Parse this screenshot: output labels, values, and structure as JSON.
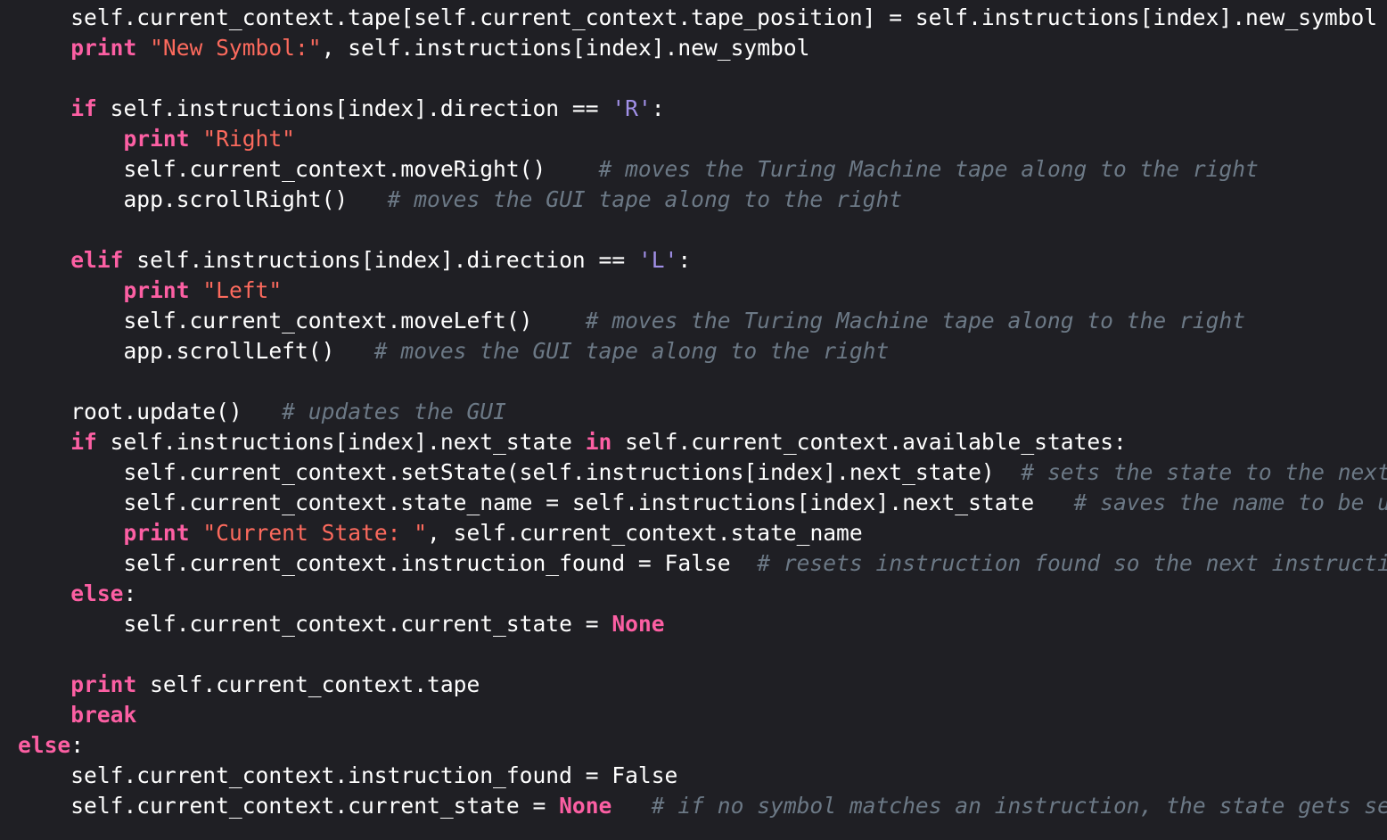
{
  "colors": {
    "background": "#1f1f24",
    "plain": "#ffffff",
    "keyword": "#fc5fa3",
    "string": "#fc6a5d",
    "char_literal": "#a190e8",
    "comment": "#6c7986"
  },
  "lines": [
    {
      "indent": 1,
      "tokens": [
        {
          "t": "self.current_context.tape[self.current_context.tape_position] = self.instructions[index].new_symbol",
          "k": "id"
        }
      ]
    },
    {
      "indent": 1,
      "tokens": [
        {
          "t": "print",
          "k": "kw"
        },
        {
          "t": " ",
          "k": "id"
        },
        {
          "t": "\"New Symbol:\"",
          "k": "str"
        },
        {
          "t": ", self.instructions[index].new_symbol",
          "k": "id"
        }
      ]
    },
    {
      "indent": 0,
      "tokens": []
    },
    {
      "indent": 1,
      "tokens": [
        {
          "t": "if",
          "k": "kw"
        },
        {
          "t": " self.instructions[index].direction == ",
          "k": "id"
        },
        {
          "t": "'R'",
          "k": "chr"
        },
        {
          "t": ":",
          "k": "id"
        }
      ]
    },
    {
      "indent": 2,
      "tokens": [
        {
          "t": "print",
          "k": "kw"
        },
        {
          "t": " ",
          "k": "id"
        },
        {
          "t": "\"Right\"",
          "k": "str"
        }
      ]
    },
    {
      "indent": 2,
      "tokens": [
        {
          "t": "self.current_context.moveRight()    ",
          "k": "id"
        },
        {
          "t": "# moves the Turing Machine tape along to the right",
          "k": "cmt"
        }
      ]
    },
    {
      "indent": 2,
      "tokens": [
        {
          "t": "app.scrollRight()   ",
          "k": "id"
        },
        {
          "t": "# moves the GUI tape along to the right",
          "k": "cmt"
        }
      ]
    },
    {
      "indent": 0,
      "tokens": []
    },
    {
      "indent": 1,
      "tokens": [
        {
          "t": "elif",
          "k": "kw"
        },
        {
          "t": " self.instructions[index].direction == ",
          "k": "id"
        },
        {
          "t": "'L'",
          "k": "chr"
        },
        {
          "t": ":",
          "k": "id"
        }
      ]
    },
    {
      "indent": 2,
      "tokens": [
        {
          "t": "print",
          "k": "kw"
        },
        {
          "t": " ",
          "k": "id"
        },
        {
          "t": "\"Left\"",
          "k": "str"
        }
      ]
    },
    {
      "indent": 2,
      "tokens": [
        {
          "t": "self.current_context.moveLeft()    ",
          "k": "id"
        },
        {
          "t": "# moves the Turing Machine tape along to the right",
          "k": "cmt"
        }
      ]
    },
    {
      "indent": 2,
      "tokens": [
        {
          "t": "app.scrollLeft()   ",
          "k": "id"
        },
        {
          "t": "# moves the GUI tape along to the right",
          "k": "cmt"
        }
      ]
    },
    {
      "indent": 0,
      "tokens": []
    },
    {
      "indent": 1,
      "tokens": [
        {
          "t": "root.update()   ",
          "k": "id"
        },
        {
          "t": "# updates the GUI",
          "k": "cmt"
        }
      ]
    },
    {
      "indent": 1,
      "tokens": [
        {
          "t": "if",
          "k": "kw"
        },
        {
          "t": " self.instructions[index].next_state ",
          "k": "id"
        },
        {
          "t": "in",
          "k": "kw"
        },
        {
          "t": " self.current_context.available_states:",
          "k": "id"
        }
      ]
    },
    {
      "indent": 2,
      "tokens": [
        {
          "t": "self.current_context.setState(self.instructions[index].next_state)  ",
          "k": "id"
        },
        {
          "t": "# sets the state to the next",
          "k": "cmt"
        }
      ]
    },
    {
      "indent": 2,
      "tokens": [
        {
          "t": "self.current_context.state_name = self.instructions[index].next_state   ",
          "k": "id"
        },
        {
          "t": "# saves the name to be u",
          "k": "cmt"
        }
      ]
    },
    {
      "indent": 2,
      "tokens": [
        {
          "t": "print",
          "k": "kw"
        },
        {
          "t": " ",
          "k": "id"
        },
        {
          "t": "\"Current State: \"",
          "k": "str"
        },
        {
          "t": ", self.current_context.state_name",
          "k": "id"
        }
      ]
    },
    {
      "indent": 2,
      "tokens": [
        {
          "t": "self.current_context.instruction_found = False  ",
          "k": "id"
        },
        {
          "t": "# resets instruction found so the next instructi",
          "k": "cmt"
        }
      ]
    },
    {
      "indent": 1,
      "tokens": [
        {
          "t": "else",
          "k": "kw"
        },
        {
          "t": ":",
          "k": "id"
        }
      ]
    },
    {
      "indent": 2,
      "tokens": [
        {
          "t": "self.current_context.current_state = ",
          "k": "id"
        },
        {
          "t": "None",
          "k": "kw"
        }
      ]
    },
    {
      "indent": 0,
      "tokens": []
    },
    {
      "indent": 1,
      "tokens": [
        {
          "t": "print",
          "k": "kw"
        },
        {
          "t": " self.current_context.tape",
          "k": "id"
        }
      ]
    },
    {
      "indent": 1,
      "tokens": [
        {
          "t": "break",
          "k": "kw"
        }
      ]
    },
    {
      "indent": 0,
      "tokens": [
        {
          "t": "else",
          "k": "kw"
        },
        {
          "t": ":",
          "k": "id"
        }
      ]
    },
    {
      "indent": 1,
      "tokens": [
        {
          "t": "self.current_context.instruction_found = False",
          "k": "id"
        }
      ]
    },
    {
      "indent": 1,
      "tokens": [
        {
          "t": "self.current_context.current_state = ",
          "k": "id"
        },
        {
          "t": "None",
          "k": "kw"
        },
        {
          "t": "   ",
          "k": "id"
        },
        {
          "t": "# if no symbol matches an instruction, the state gets se",
          "k": "cmt"
        }
      ]
    }
  ]
}
